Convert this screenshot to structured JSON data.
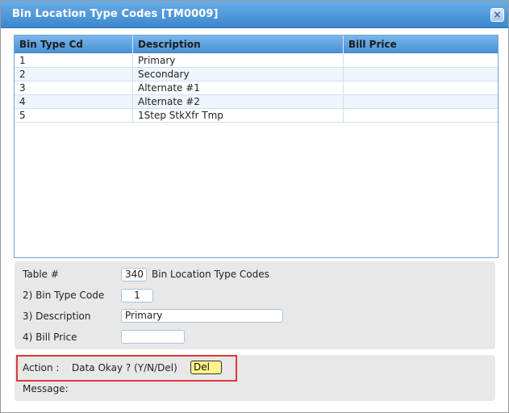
{
  "window": {
    "title": "Bin Location Type Codes [TM0009]",
    "close_glyph": "×",
    "close_icon": "close-icon"
  },
  "grid": {
    "columns": [
      "Bin Type Cd",
      "Description",
      "Bill Price"
    ],
    "rows": [
      {
        "code": "1",
        "description": "Primary",
        "bill_price": ""
      },
      {
        "code": "2",
        "description": "Secondary",
        "bill_price": ""
      },
      {
        "code": "3",
        "description": "Alternate #1",
        "bill_price": ""
      },
      {
        "code": "4",
        "description": "Alternate #2",
        "bill_price": ""
      },
      {
        "code": "5",
        "description": "1Step StkXfr Tmp",
        "bill_price": ""
      }
    ]
  },
  "form": {
    "table_label": "Table #",
    "table_number": "340",
    "table_name": "Bin Location Type Codes",
    "bin_type_code_label": "2) Bin Type Code",
    "bin_type_code_value": "1",
    "description_label": "3) Description",
    "description_value": "Primary",
    "bill_price_label": "4) Bill Price",
    "bill_price_value": ""
  },
  "action": {
    "label": "Action :",
    "prompt": "Data Okay ? (Y/N/Del)",
    "value": "Del",
    "message_label": "Message:",
    "highlight_color": "#d9393a",
    "input_color": "#fff38a"
  },
  "colors": {
    "titlebar": "#3a86cf",
    "grid_header": "#4a92d6",
    "panel": "#e8e8e8"
  }
}
